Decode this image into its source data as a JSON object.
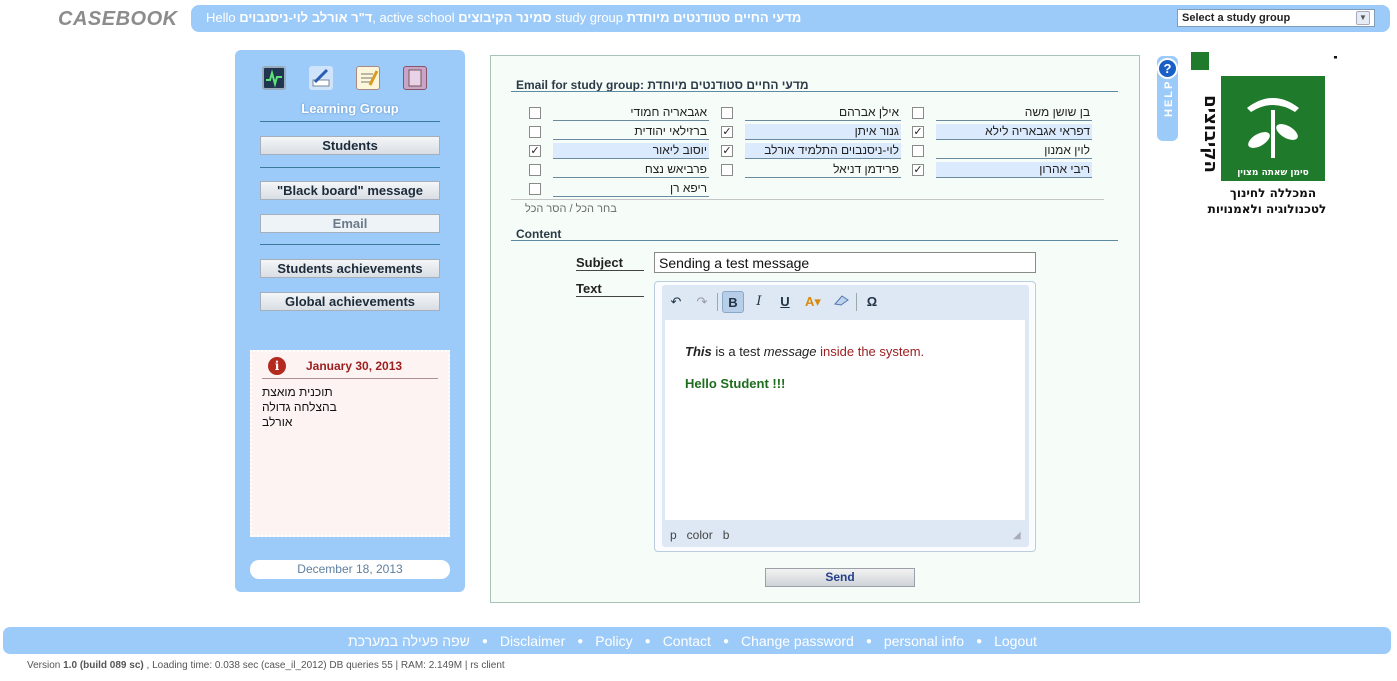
{
  "app": {
    "logo": "CASEBOOK",
    "greeting_prefix": "Hello",
    "user_name": "ד\"ר אורלב לוי-ניסנבוים",
    "active_school_label": ", active school",
    "school_name": "סמינר הקיבוצים",
    "study_group_label": "study group",
    "group_name": "מדעי החיים סטודנטים מיוחדת",
    "study_select_placeholder": "Select a study group"
  },
  "sidebar": {
    "section_title": "Learning Group",
    "buttons": {
      "students": "Students",
      "blackboard": "\"Black board\" message",
      "email": "Email",
      "students_achievements": "Students achievements",
      "global_achievements": "Global achievements"
    },
    "notice": {
      "date": "January 30, 2013",
      "text": "תוכנית מואצת\nבהצלחה גדולה\nאורלב"
    },
    "footer_date": "December 18, 2013"
  },
  "email": {
    "title_prefix": "Email for study group:",
    "title_group": "מדעי החיים סטודנטים מיוחדת",
    "students": [
      {
        "name": "בן שושן משה",
        "checked": false
      },
      {
        "name": "דפראי אגבאריה לילא",
        "checked": true
      },
      {
        "name": "לוין אמנון",
        "checked": false
      },
      {
        "name": "ריבי אהרון",
        "checked": true
      },
      {
        "name": "אילן אברהם",
        "checked": false
      },
      {
        "name": "גנור איתן",
        "checked": true
      },
      {
        "name": "לוי-ניסנבוים התלמיד אורלב",
        "checked": true
      },
      {
        "name": "פרידמן דניאל",
        "checked": false
      },
      {
        "name": "אגבאריה חמודי",
        "checked": false
      },
      {
        "name": "ברזילאי יהודית",
        "checked": false
      },
      {
        "name": "יוסוב ליאור",
        "checked": true
      },
      {
        "name": "פרביאש נצח",
        "checked": false
      },
      {
        "name": "ריפא רן",
        "checked": false
      }
    ],
    "select_all": "בחר הכל",
    "deselect_all": "הסר הכל",
    "select_sep": "/",
    "content_title": "Content",
    "subject_label": "Subject",
    "subject_value": "Sending a test message",
    "text_label": "Text",
    "editor": {
      "line1_italic": "This",
      "line1_a": " is a test ",
      "line1_em": "message",
      "line1_red": " inside the system.",
      "line2": "Hello Student !!!",
      "status_path": "p   color   b"
    },
    "send_label": "Send"
  },
  "help_label": "HELP",
  "brand": {
    "name": "סמינר הקיבוצים",
    "tagline1": "סימן שאתה מצוין",
    "tagline2": "המכללה לחינוך",
    "tagline3": "לטכנולוגיה ולאמנויות",
    "color": "#1f7a2c"
  },
  "footer": {
    "links": [
      "שפה פעילה במערכת",
      "Disclaimer",
      "Policy",
      "Contact",
      "Change password",
      "personal info",
      "Logout"
    ],
    "version_prefix": "Version ",
    "version_num": "1.0 (build 089 sc)",
    "version_rest": " , Loading time: 0.038 sec  (case_il_2012) DB queries 55 | RAM: 2.149M | rs client"
  },
  "colors": {
    "accent": "#9ccbf9",
    "panel_bg": "#f6fdf8",
    "notice_bg": "#fdf3f2"
  }
}
